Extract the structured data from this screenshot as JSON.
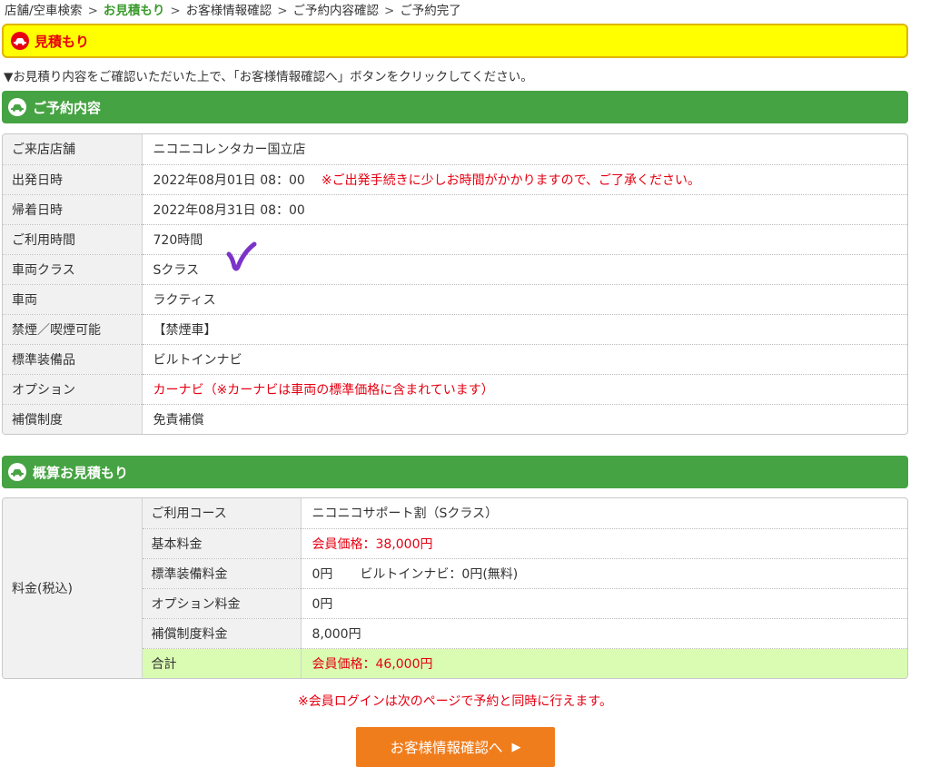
{
  "breadcrumb": {
    "steps": [
      "店舗/空車検索",
      "お見積もり",
      "お客様情報確認",
      "ご予約内容確認",
      "ご予約完了"
    ],
    "separator": ">"
  },
  "header": {
    "title": "見積もり"
  },
  "instruction": "▼お見積り内容をご確認いただいた上で、「お客様情報確認へ」ボタンをクリックしてください。",
  "reservation": {
    "title": "ご予約内容",
    "rows": [
      {
        "label": "ご来店店舗",
        "value": "ニコニコレンタカー国立店"
      },
      {
        "label": "出発日時",
        "value": "2022年08月01日 08：00",
        "note": "※ご出発手続きに少しお時間がかかりますので、ご了承ください。"
      },
      {
        "label": "帰着日時",
        "value": "2022年08月31日 08：00"
      },
      {
        "label": "ご利用時間",
        "value": "720時間"
      },
      {
        "label": "車両クラス",
        "value": "Sクラス"
      },
      {
        "label": "車両",
        "value": "ラクティス"
      },
      {
        "label": "禁煙／喫煙可能",
        "value": "【禁煙車】"
      },
      {
        "label": "標準装備品",
        "value": "ビルトインナビ"
      },
      {
        "label": "オプション",
        "value": "カーナビ（※カーナビは車両の標準価格に含まれています）"
      },
      {
        "label": "補償制度",
        "value": "免責補償"
      }
    ]
  },
  "estimate": {
    "title": "概算お見積もり",
    "group_label": "料金(税込)",
    "rows": [
      {
        "label": "ご利用コース",
        "value": "ニコニコサポート割（Sクラス）"
      },
      {
        "label": "基本料金",
        "value": "会員価格：38,000円"
      },
      {
        "label": "標準装備料金",
        "value": "0円",
        "extra": "ビルトインナビ：0円(無料)"
      },
      {
        "label": "オプション料金",
        "value": "0円"
      },
      {
        "label": "補償制度料金",
        "value": "8,000円"
      },
      {
        "label": "合計",
        "value": "会員価格：46,000円"
      }
    ]
  },
  "login_note": "※会員ログインは次のページで予約と同時に行えます。",
  "next_button": {
    "label": "お客様情報確認へ",
    "arrow": "▶"
  },
  "colors": {
    "accent_green": "#46a343",
    "header_yellow": "#ffff00",
    "alert_red": "#e60012",
    "button_orange": "#f07d1c",
    "total_highlight": "#d9fbb2",
    "checkmark_purple": "#7b33c9"
  },
  "icons": {
    "header": "car-icon",
    "section": "car-icon",
    "annotation": "checkmark-icon"
  }
}
